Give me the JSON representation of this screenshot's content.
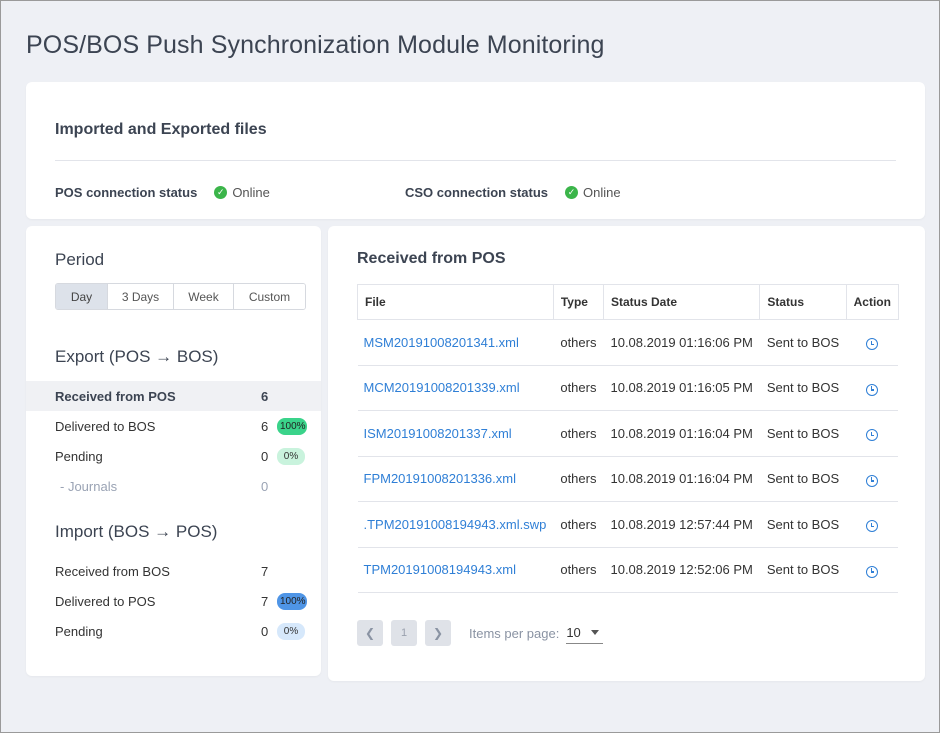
{
  "page_title": "POS/BOS Push Synchronization Module Monitoring",
  "summary": {
    "title": "Imported and Exported files",
    "pos_connection": {
      "label": "POS connection status",
      "status": "Online",
      "status_icon": "check-icon"
    },
    "cso_connection": {
      "label": "CSO connection status",
      "status": "Online",
      "status_icon": "check-icon"
    }
  },
  "period": {
    "title": "Period",
    "options": [
      "Day",
      "3 Days",
      "Week",
      "Custom"
    ],
    "selected": "Day"
  },
  "export": {
    "title": "Export (POS → BOS)",
    "rows": [
      {
        "label": "Received from POS",
        "value": "6",
        "badge": ""
      },
      {
        "label": "Delivered to BOS",
        "value": "6",
        "badge": "100%"
      },
      {
        "label": "Pending",
        "value": "0",
        "badge": "0%"
      },
      {
        "label": "- Journals",
        "value": "0",
        "badge": ""
      }
    ]
  },
  "import": {
    "title": "Import (BOS → POS)",
    "rows": [
      {
        "label": "Received from BOS",
        "value": "7",
        "badge": ""
      },
      {
        "label": "Delivered to POS",
        "value": "7",
        "badge": "100%"
      },
      {
        "label": "Pending",
        "value": "0",
        "badge": "0%"
      }
    ]
  },
  "received": {
    "title": "Received from POS",
    "columns": [
      "File",
      "Type",
      "Status Date",
      "Status",
      "Action"
    ],
    "rows": [
      {
        "file": "MSM20191008201341.xml",
        "type": "others",
        "date": "10.08.2019 01:16:06 PM",
        "status": "Sent to BOS"
      },
      {
        "file": "MCM20191008201339.xml",
        "type": "others",
        "date": "10.08.2019 01:16:05 PM",
        "status": "Sent to BOS"
      },
      {
        "file": "ISM20191008201337.xml",
        "type": "others",
        "date": "10.08.2019 01:16:04 PM",
        "status": "Sent to BOS"
      },
      {
        "file": "FPM20191008201336.xml",
        "type": "others",
        "date": "10.08.2019 01:16:04 PM",
        "status": "Sent to BOS"
      },
      {
        "file": ".TPM20191008194943.xml.swp",
        "type": "others",
        "date": "10.08.2019 12:57:44 PM",
        "status": "Sent to BOS"
      },
      {
        "file": "TPM20191008194943.xml",
        "type": "others",
        "date": "10.08.2019 12:52:06 PM",
        "status": "Sent to BOS"
      }
    ],
    "action_icon": "clock-icon"
  },
  "pagination": {
    "current_page": "1",
    "items_per_page_label": "Items per page:",
    "items_per_page": "10"
  },
  "colors": {
    "link": "#2f7fd6",
    "online": "#3bb54a",
    "export_badge": "#3ad38a",
    "import_badge": "#4f95e6"
  }
}
